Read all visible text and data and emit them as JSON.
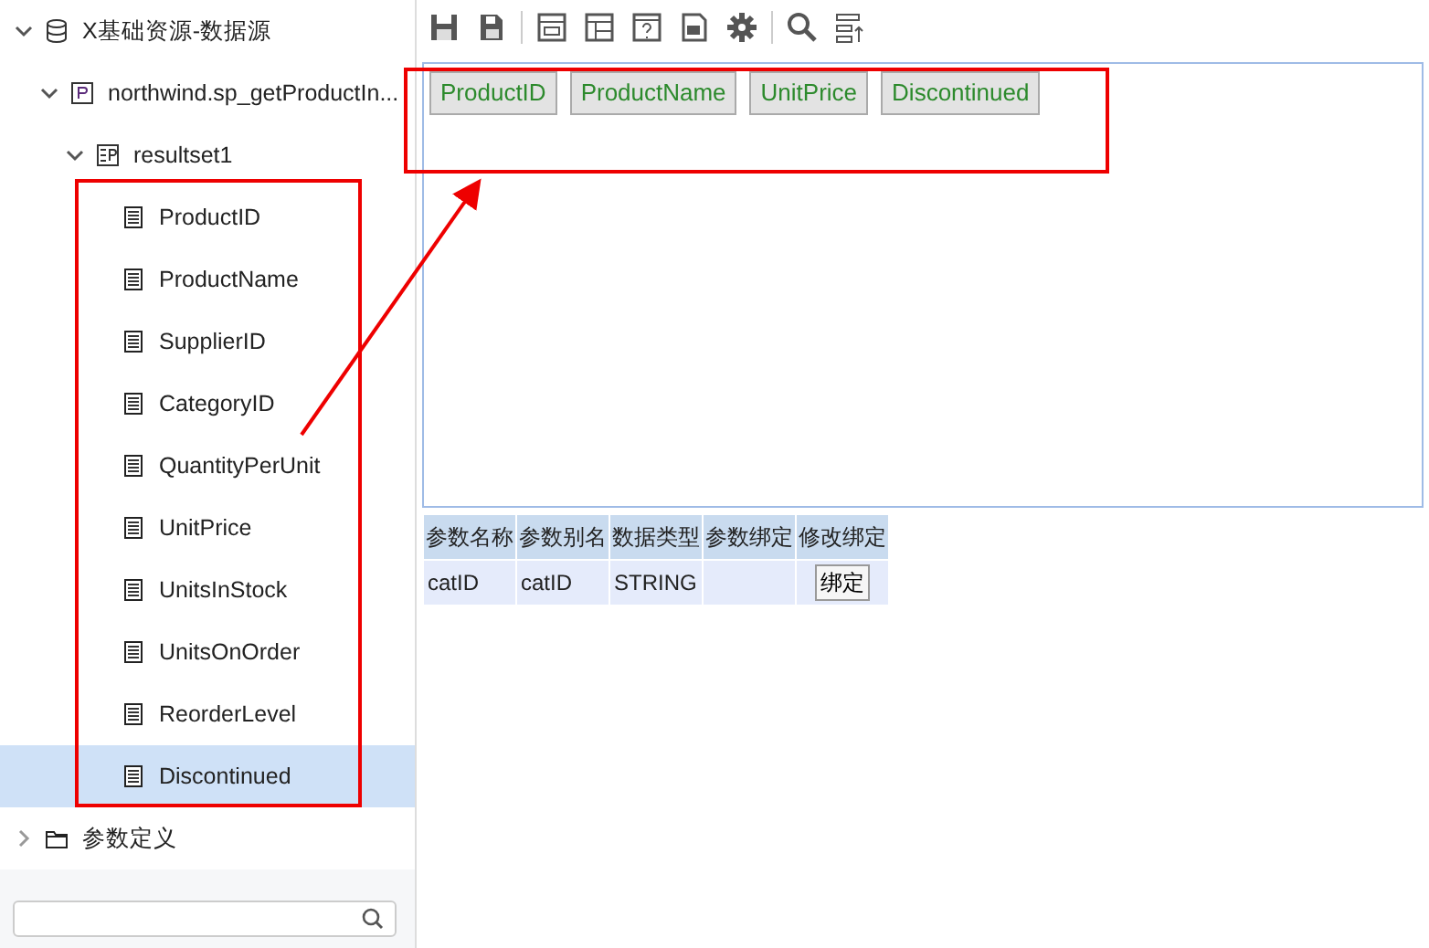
{
  "tree": [
    {
      "label": "X基础资源-数据源",
      "kind": "database",
      "expanded": true,
      "selected": false,
      "children": [
        {
          "label": "northwind.sp_getProductIn...",
          "kind": "procedure",
          "expanded": true,
          "selected": false,
          "children": [
            {
              "label": "resultset1",
              "kind": "resultset",
              "expanded": true,
              "selected": false,
              "children": [
                {
                  "label": "ProductID",
                  "kind": "field",
                  "selected": false
                },
                {
                  "label": "ProductName",
                  "kind": "field",
                  "selected": false
                },
                {
                  "label": "SupplierID",
                  "kind": "field",
                  "selected": false
                },
                {
                  "label": "CategoryID",
                  "kind": "field",
                  "selected": false
                },
                {
                  "label": "QuantityPerUnit",
                  "kind": "field",
                  "selected": false
                },
                {
                  "label": "UnitPrice",
                  "kind": "field",
                  "selected": false
                },
                {
                  "label": "UnitsInStock",
                  "kind": "field",
                  "selected": false
                },
                {
                  "label": "UnitsOnOrder",
                  "kind": "field",
                  "selected": false
                },
                {
                  "label": "ReorderLevel",
                  "kind": "field",
                  "selected": false
                },
                {
                  "label": "Discontinued",
                  "kind": "field",
                  "selected": true
                }
              ]
            }
          ]
        }
      ]
    },
    {
      "label": "参数定义",
      "kind": "folder",
      "expanded": false,
      "selected": false
    }
  ],
  "design_fields": [
    "ProductID",
    "ProductName",
    "UnitPrice",
    "Discontinued"
  ],
  "params": {
    "columns": [
      "参数名称",
      "参数别名",
      "数据类型",
      "参数绑定",
      "修改绑定"
    ],
    "rows": [
      {
        "name": "catID",
        "alias": "catID",
        "type": "STRING",
        "binding": "",
        "button": "绑定"
      }
    ]
  }
}
